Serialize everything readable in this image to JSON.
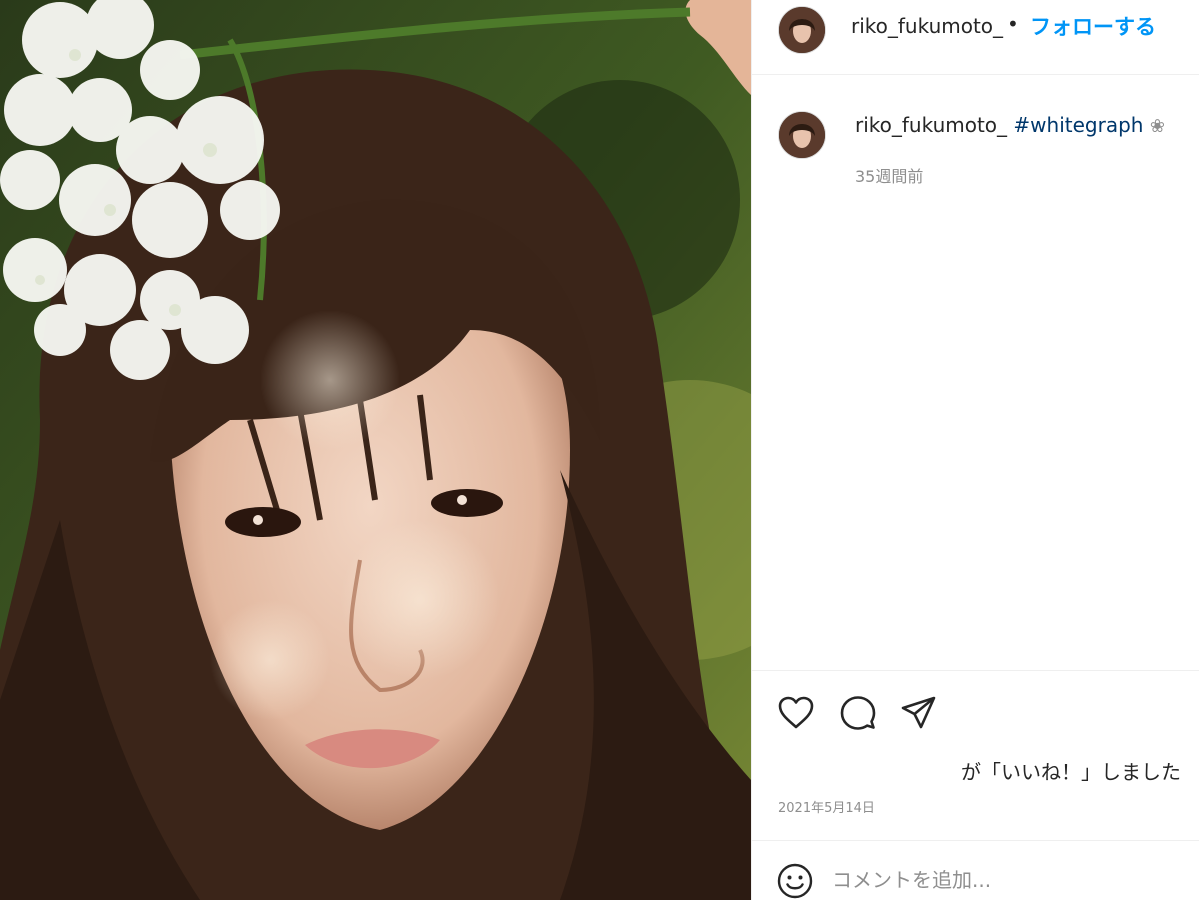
{
  "post": {
    "image_alt": "photo",
    "colors": {
      "follow": "#0095f6",
      "hashtag": "#00376b",
      "muted": "#8e8e8e"
    }
  },
  "header": {
    "username": "riko_fukumoto_",
    "separator": "•",
    "follow_label": "フォローする"
  },
  "caption": {
    "username": "riko_fukumoto_",
    "hashtag": "#whitegraph",
    "emoji": "❀",
    "time_ago": "35週間前"
  },
  "actions": {
    "icons": [
      "heart-icon",
      "comment-icon",
      "share-icon"
    ],
    "likes_text": "が「いいね！」しました",
    "date": "2021年5月14日"
  },
  "comment": {
    "placeholder": "コメントを追加..."
  }
}
